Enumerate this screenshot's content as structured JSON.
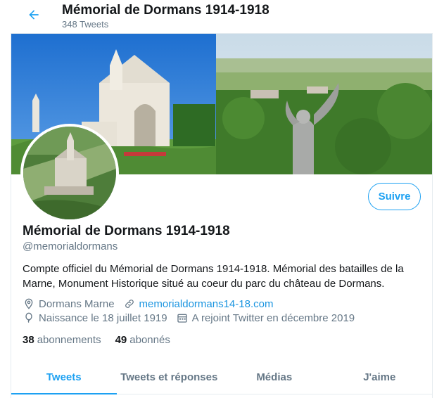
{
  "header": {
    "title": "Mémorial de Dormans 1914-1918",
    "tweet_count": "348 Tweets"
  },
  "profile": {
    "name": "Mémorial de Dormans 1914-1918",
    "handle": "@memorialdormans",
    "bio": "Compte officiel du Mémorial de Dormans 1914-1918. Mémorial des batailles de la Marne, Monument Historique situé au coeur du parc du château de Dormans.",
    "follow_label": "Suivre",
    "location": "Dormans Marne",
    "website": "memorialdormans14-18.com",
    "birth": "Naissance le 18 juillet 1919",
    "joined": "A rejoint Twitter en décembre 2019",
    "accent_color": "#1da1f2"
  },
  "stats": {
    "following_count": "38",
    "following_label": "abonnements",
    "followers_count": "49",
    "followers_label": "abonnés"
  },
  "tabs": [
    {
      "label": "Tweets",
      "active": true
    },
    {
      "label": "Tweets et réponses",
      "active": false
    },
    {
      "label": "Médias",
      "active": false
    },
    {
      "label": "J'aime",
      "active": false
    }
  ],
  "icons": {
    "back": "arrow-left-icon",
    "location": "location-pin-icon",
    "link": "link-icon",
    "birth": "balloon-icon",
    "calendar": "calendar-icon"
  }
}
